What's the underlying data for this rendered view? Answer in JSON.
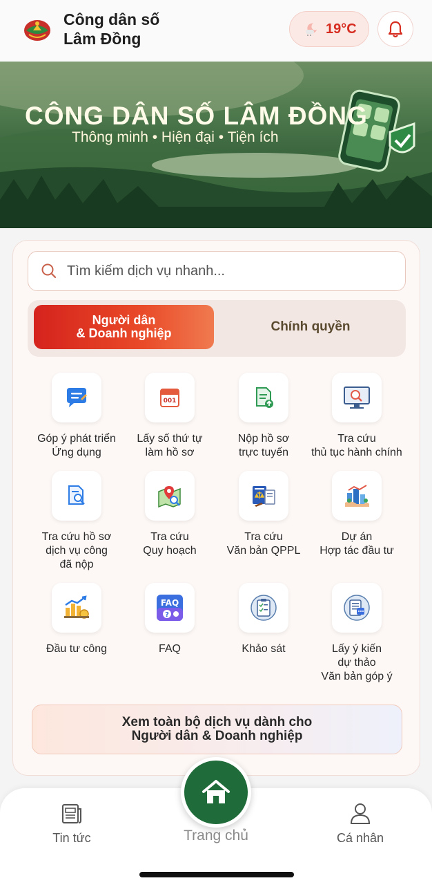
{
  "header": {
    "title_line1": "Công dân số",
    "title_line2": "Lâm Đồng",
    "weather_temp": "19°C",
    "weather_icon": "partly-cloudy-night-icon",
    "bell_icon": "bell-icon"
  },
  "banner": {
    "title": "CÔNG DÂN SỐ LÂM ĐỒNG",
    "subtitle": "Thông minh • Hiện đại • Tiện ích"
  },
  "search": {
    "placeholder": "Tìm kiếm dịch vụ nhanh..."
  },
  "segments": {
    "active_line1": "Người dân",
    "active_line2": "& Doanh nghiệp",
    "inactive": "Chính quyền"
  },
  "services": [
    {
      "label": "Góp ý phát triển\nỨng dụng",
      "icon": "feedback-chat-icon"
    },
    {
      "label": "Lấy số thứ tự\nlàm hồ sơ",
      "icon": "queue-ticket-icon"
    },
    {
      "label": "Nộp hồ sơ\ntrực tuyến",
      "icon": "upload-document-icon"
    },
    {
      "label": "Tra cứu\nthủ tục hành chính",
      "icon": "search-procedure-icon"
    },
    {
      "label": "Tra cứu hồ sơ\ndịch vụ công\nđã nộp",
      "icon": "search-document-icon"
    },
    {
      "label": "Tra cứu\nQuy hoạch",
      "icon": "map-search-icon"
    },
    {
      "label": "Tra cứu\nVăn bản QPPL",
      "icon": "law-book-icon"
    },
    {
      "label": "Dự án\nHợp tác đầu tư",
      "icon": "investment-project-icon"
    },
    {
      "label": "Đầu tư công",
      "icon": "public-investment-icon"
    },
    {
      "label": "FAQ",
      "icon": "faq-icon"
    },
    {
      "label": "Khảo sát",
      "icon": "survey-icon"
    },
    {
      "label": "Lấy ý kiến\ndự thảo\nVăn bản góp ý",
      "icon": "draft-opinion-icon"
    }
  ],
  "view_all": {
    "line1": "Xem toàn bộ dịch vụ dành cho",
    "line2": "Người dân & Doanh nghiệp"
  },
  "bottom_nav": {
    "news": "Tin tức",
    "home": "Trang chủ",
    "profile": "Cá nhân"
  },
  "colors": {
    "primary_red": "#d62d20",
    "primary_green": "#1f6b3a"
  }
}
